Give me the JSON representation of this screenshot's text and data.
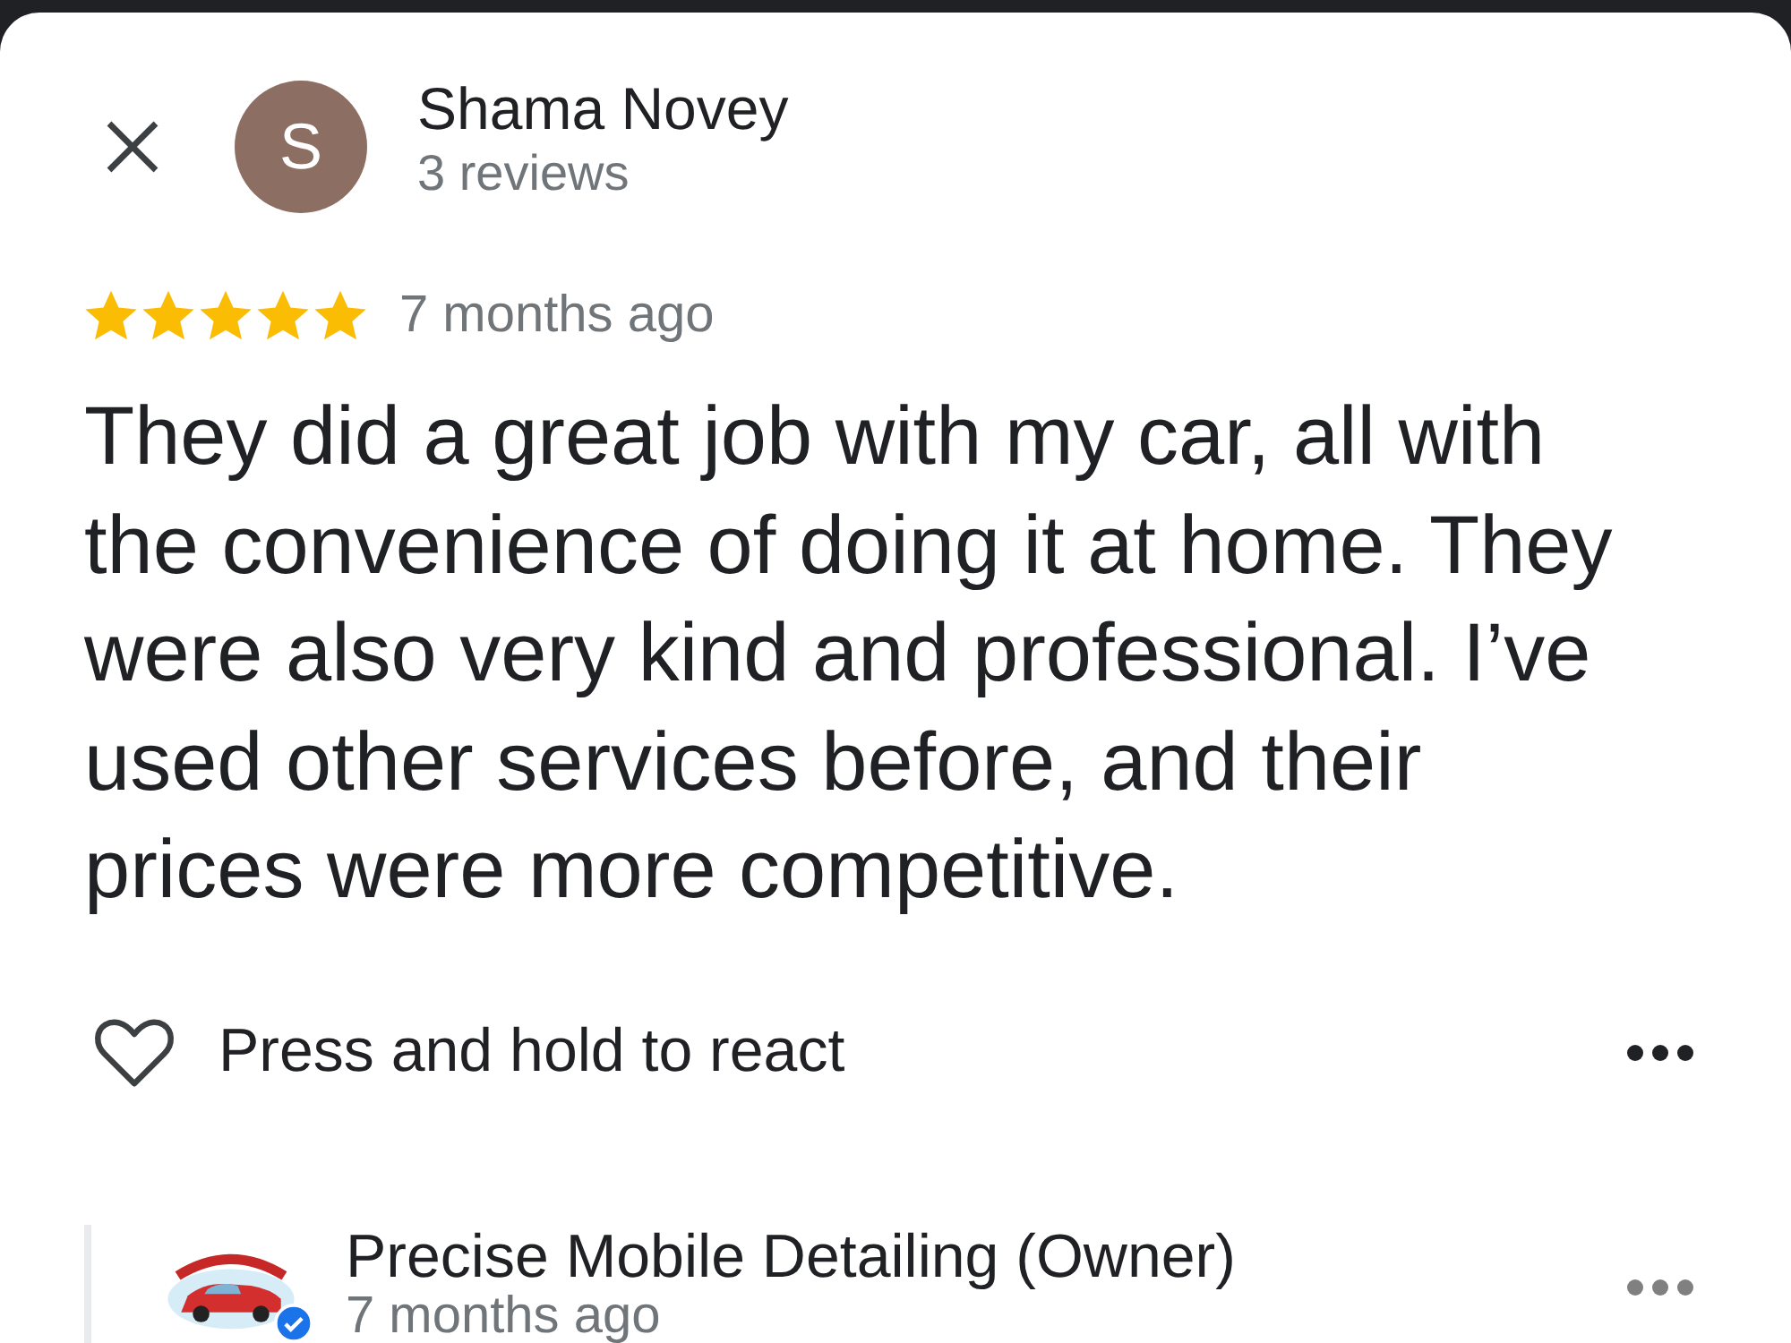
{
  "reviewer": {
    "initial": "S",
    "name": "Shama Novey",
    "review_count": "3 reviews"
  },
  "review": {
    "stars": 5,
    "time": "7 months ago",
    "text": "They did a great job with my car, all with the convenience of doing it at home. They were also very kind and professional. I’ve used other services before, and their prices were more competitive.",
    "reaction_prompt": "Press and hold to react"
  },
  "owner_reply": {
    "name": "Precise Mobile Detailing (Owner)",
    "time": "7 months ago",
    "verified": true
  }
}
